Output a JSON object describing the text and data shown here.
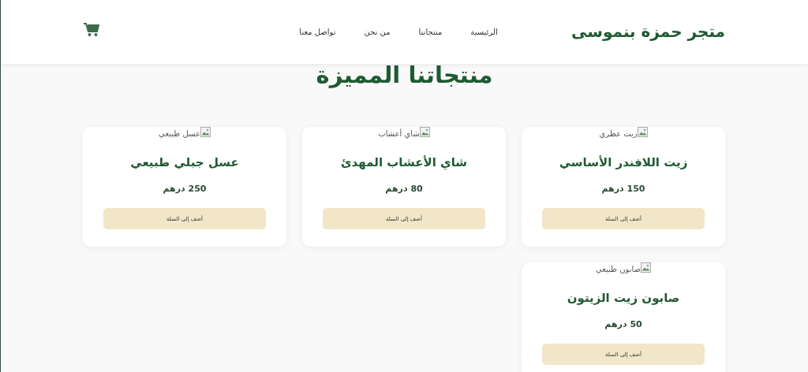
{
  "header": {
    "logo": "متجر حمزة بنموسى",
    "nav": [
      {
        "label": "الرئيسية"
      },
      {
        "label": "منتجاتنا"
      },
      {
        "label": "من نحن"
      },
      {
        "label": "تواصل معنا"
      }
    ]
  },
  "section_title": "منتجاتنا المميزة",
  "products": [
    {
      "image_alt": "زيت عطري",
      "name": "زيت اللافندر الأساسي",
      "price": "150 درهم",
      "button": "أضف إلى السلة"
    },
    {
      "image_alt": "شاي أعشاب",
      "name": "شاي الأعشاب المهدئ",
      "price": "80 درهم",
      "button": "أضف إلى السلة"
    },
    {
      "image_alt": "عسل طبيعي",
      "name": "عسل جبلي طبيعي",
      "price": "250 درهم",
      "button": "أضف إلى السلة"
    },
    {
      "image_alt": "صابون طبيعي",
      "name": "صابون زيت الزيتون",
      "price": "50 درهم",
      "button": "أضف إلى السلة"
    }
  ]
}
